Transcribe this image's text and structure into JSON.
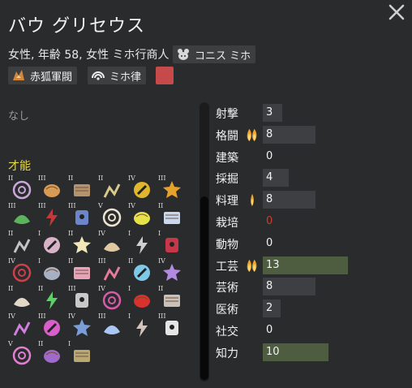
{
  "window": {
    "title": "バウ グリセウス"
  },
  "header": {
    "subtitle": "女性, 年齢 58, 女性 ミホ行商人",
    "tags": [
      {
        "label": "コニス ミホ",
        "icon": "animal-icon"
      },
      {
        "label": "赤狐軍閥",
        "icon": "fox-faction-icon"
      },
      {
        "label": "ミホ律",
        "icon": "ideology-icon"
      }
    ],
    "color_swatch": "#c64a4a"
  },
  "left": {
    "none_label": "なし",
    "traits_label": "才能"
  },
  "genes": [
    {
      "lvl": "II",
      "icon": "ring-icon",
      "color": "#c9a7d9"
    },
    {
      "lvl": "III",
      "icon": "brain-icon",
      "color": "#d89b55"
    },
    {
      "lvl": "II",
      "icon": "leaf-panel-icon",
      "color": "#b5936f"
    },
    {
      "lvl": "II",
      "icon": "mining-icon",
      "color": "#d9c98c"
    },
    {
      "lvl": "IV",
      "icon": "storm-icon",
      "color": "#e0b72b"
    },
    {
      "lvl": "III",
      "icon": "gear-icon",
      "color": "#e6a22a"
    },
    {
      "lvl": "III",
      "icon": "smile-icon",
      "color": "#5db35b"
    },
    {
      "lvl": "III",
      "icon": "bomb-icon",
      "color": "#c23a3a"
    },
    {
      "lvl": "III",
      "icon": "face-icon",
      "color": "#6c86c9"
    },
    {
      "lvl": "V",
      "icon": "cloud-icon",
      "color": "#ece3d0"
    },
    {
      "lvl": "IV",
      "icon": "lightning-icon",
      "color": "#e6e24a"
    },
    {
      "lvl": "II",
      "icon": "scroll-icon",
      "color": "#c9d7ef"
    },
    {
      "lvl": "II",
      "icon": "rock-icon",
      "color": "#c4c4c4"
    },
    {
      "lvl": "I",
      "icon": "fur-icon",
      "color": "#d8b3c7"
    },
    {
      "lvl": "II",
      "icon": "fox-head-icon",
      "color": "#f2e7b8"
    },
    {
      "lvl": "IV",
      "icon": "cards-icon",
      "color": "#e0c9a0"
    },
    {
      "lvl": "I",
      "icon": "tools-icon",
      "color": "#cfcfcf"
    },
    {
      "lvl": "I",
      "icon": "feather-icon",
      "color": "#c7374a"
    },
    {
      "lvl": "IV",
      "icon": "blade-icon",
      "color": "#c8414b"
    },
    {
      "lvl": "I",
      "icon": "bird-icon",
      "color": "#a8b0c4"
    },
    {
      "lvl": "II",
      "icon": "heart-face-icon",
      "color": "#e7a3b8"
    },
    {
      "lvl": "III",
      "icon": "heart-drop-icon",
      "color": "#e67b99"
    },
    {
      "lvl": "II",
      "icon": "swallow-icon",
      "color": "#7fc9e8"
    },
    {
      "lvl": "IV",
      "icon": "web-icon",
      "color": "#b28ae0"
    },
    {
      "lvl": "II",
      "icon": "mask-icon",
      "color": "#e3d8c8"
    },
    {
      "lvl": "II",
      "icon": "medical-icon",
      "color": "#5ecf6a"
    },
    {
      "lvl": "III",
      "icon": "barrel-icon",
      "color": "#c9c9c9"
    },
    {
      "lvl": "IV",
      "icon": "eyes-icon",
      "color": "#d75ba8"
    },
    {
      "lvl": "I",
      "icon": "blob-icon",
      "color": "#d8322e"
    },
    {
      "lvl": "II",
      "icon": "figures-icon",
      "color": "#c9c0b8"
    },
    {
      "lvl": "IV",
      "icon": "crescent-icon",
      "color": "#d07fe0"
    },
    {
      "lvl": "III",
      "icon": "crown-icon",
      "color": "#d85fc9"
    },
    {
      "lvl": "IV",
      "icon": "orb-icon",
      "color": "#7a9ed9"
    },
    {
      "lvl": "III",
      "icon": "sparkle-icon",
      "color": "#aac6f4"
    },
    {
      "lvl": "I",
      "icon": "dancer-icon",
      "color": "#d3c3bb"
    },
    {
      "lvl": "III",
      "icon": "skull-icon",
      "color": "#e5e5e5"
    },
    {
      "lvl": "V",
      "icon": "stars-icon",
      "color": "#e07fd0"
    },
    {
      "lvl": "II",
      "icon": "cat-icon",
      "color": "#9f6ac9"
    },
    {
      "lvl": "I",
      "icon": "hanger-icon",
      "color": "#b9a872"
    }
  ],
  "skills": [
    {
      "name": "射撃",
      "value": "3",
      "level": 3,
      "passion": 0
    },
    {
      "name": "格闘",
      "value": "8",
      "level": 8,
      "passion": 2
    },
    {
      "name": "建築",
      "value": "0",
      "level": 0,
      "passion": 0
    },
    {
      "name": "採掘",
      "value": "4",
      "level": 4,
      "passion": 0
    },
    {
      "name": "料理",
      "value": "8",
      "level": 8,
      "passion": 1
    },
    {
      "name": "栽培",
      "value": "0",
      "level": 0,
      "passion": 0,
      "disabled": true
    },
    {
      "name": "動物",
      "value": "0",
      "level": 0,
      "passion": 0
    },
    {
      "name": "工芸",
      "value": "13",
      "level": 13,
      "passion": 2
    },
    {
      "name": "芸術",
      "value": "8",
      "level": 8,
      "passion": 0
    },
    {
      "name": "医術",
      "value": "2",
      "level": 2,
      "passion": 0
    },
    {
      "name": "社交",
      "value": "0",
      "level": 0,
      "passion": 0
    },
    {
      "name": "知力",
      "value": "10",
      "level": 10,
      "passion": 0
    }
  ],
  "colors": {
    "flame": "#f0a52b",
    "flame_core": "#ffe07a",
    "high_bar": "#4e5c40",
    "bar": "#3e3f42"
  }
}
